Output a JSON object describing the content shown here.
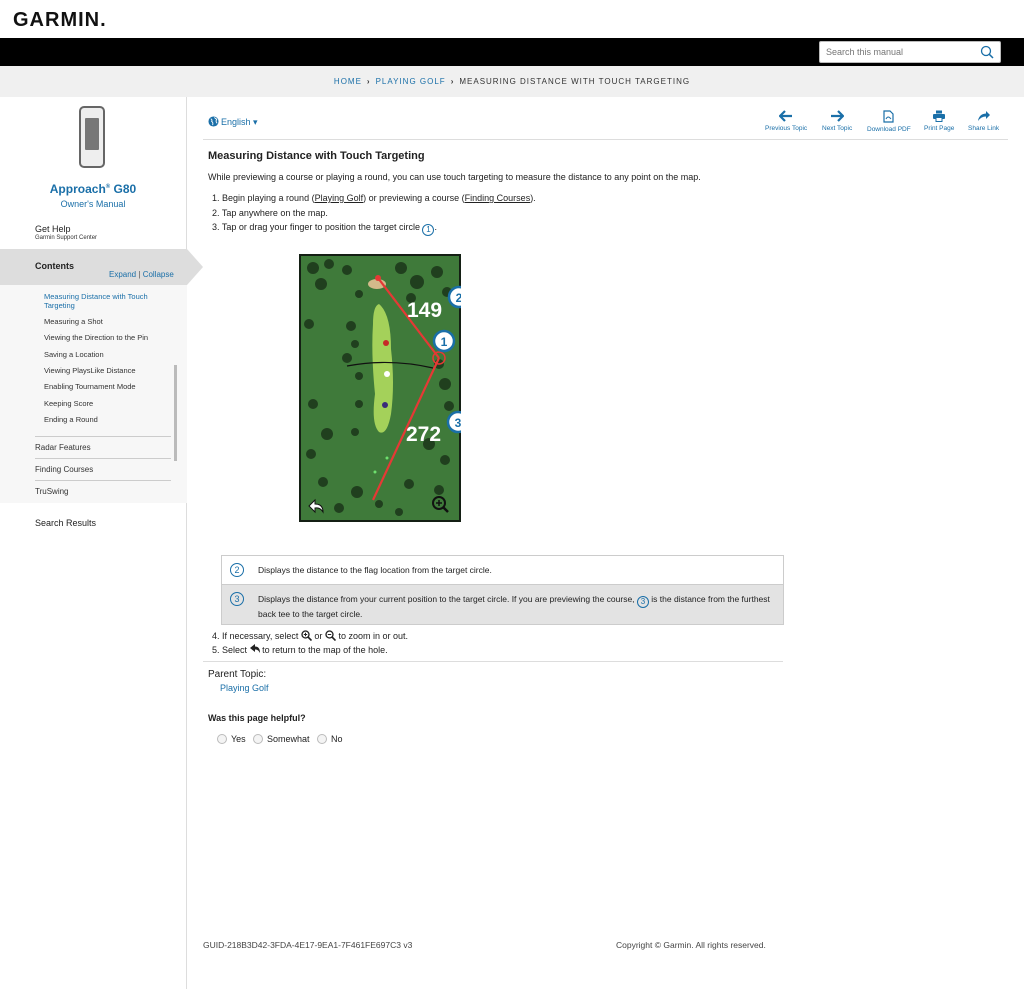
{
  "brand": {
    "logo": "GARMIN",
    "logo_mark": "."
  },
  "search": {
    "placeholder": "Search this manual"
  },
  "breadcrumb": {
    "home": "HOME",
    "section": "PLAYING GOLF",
    "current": "MEASURING DISTANCE WITH TOUCH TARGETING"
  },
  "sidebar": {
    "product_name": "Approach",
    "product_reg": "®",
    "product_model": "G80",
    "manual_label": "Owner's Manual",
    "get_help": "Get Help",
    "support_center": "Garmin Support Center",
    "contents_label": "Contents",
    "expand": "Expand",
    "pipe": "|",
    "collapse": "Collapse",
    "toc_items": [
      {
        "label": "Measuring Distance with Touch Targeting"
      },
      {
        "label": "Measuring a Shot"
      },
      {
        "label": "Viewing the Direction to the Pin"
      },
      {
        "label": "Saving a Location"
      },
      {
        "label": "Viewing PlaysLike Distance"
      },
      {
        "label": "Enabling Tournament Mode"
      },
      {
        "label": "Keeping Score"
      },
      {
        "label": "Ending a Round"
      }
    ],
    "toc_sections": [
      "Radar Features",
      "Finding Courses",
      "TruSwing"
    ],
    "search_results": "Search Results"
  },
  "toolbar": {
    "language": "English",
    "previous_topic": "Previous Topic",
    "next_topic": "Next Topic",
    "download_pdf": "Download PDF",
    "print_page": "Print Page",
    "share_link": "Share Link"
  },
  "content": {
    "title": "Measuring Distance with Touch Targeting",
    "intro": "While previewing a course or playing a round, you can use touch targeting to measure the distance to any point on the map.",
    "steps": {
      "s1_prefix": "1. Begin playing a round (",
      "s1_link1": "Playing Golf",
      "s1_mid": ") or previewing a course (",
      "s1_link2": "Finding Courses",
      "s1_suffix": ").",
      "s2": "2. Tap anywhere on the map.",
      "s3_prefix": "3. Tap or drag your finger to position the target circle",
      "s3_suffix": ".",
      "s4_prefix": "4. If necessary, select",
      "s4_or": "or",
      "s4_suffix": "to zoom in or out.",
      "s5_prefix": "5. Select",
      "s5_suffix": "to return to the map of the hole."
    },
    "callouts": {
      "c1": "1",
      "c2": "2",
      "c3": "3"
    },
    "figure": {
      "distance_flag": "149",
      "distance_tee": "272"
    },
    "legend": {
      "row1": "Displays the distance to the flag location from the target circle.",
      "row2_prefix": "Displays the distance from your current position to the target circle. If you are previewing the course,",
      "row2_suffix": "is the distance from the furthest back tee to the target circle."
    },
    "parent_label": "Parent Topic:",
    "parent_link": "Playing Golf",
    "helpful": "Was this page helpful?",
    "options": [
      "Yes",
      "Somewhat",
      "No"
    ]
  },
  "footer": {
    "guid": "GUID-218B3D42-3FDA-4E17-9EA1-7F461FE697C3 v3",
    "copyright": "Copyright © Garmin. All rights reserved."
  },
  "colors": {
    "accent": "#1a6fa8",
    "header_bg": "#000000",
    "map_green": "#3f7a3a",
    "target_line": "#e53935"
  }
}
